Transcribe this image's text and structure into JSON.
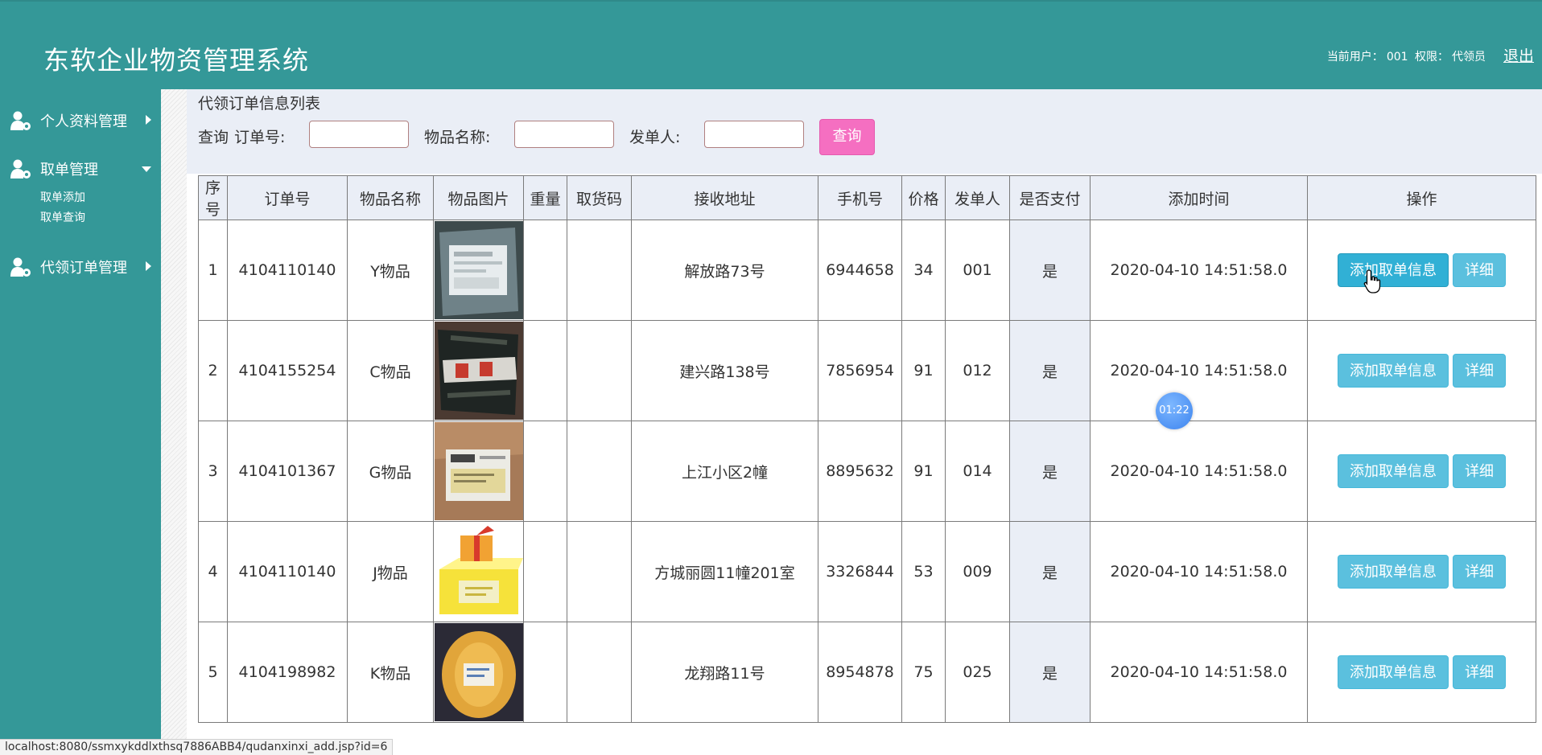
{
  "header": {
    "title": "东软企业物资管理系统",
    "current_user_label": "当前用户：",
    "current_user": "001",
    "permission_label": "权限：",
    "permission": "代领员",
    "logout": "退出"
  },
  "sidebar": {
    "menus": [
      {
        "label": "个人资料管理",
        "icon": "user-gear-icon",
        "arrow": "chevron-right-icon"
      },
      {
        "label": "取单管理",
        "icon": "user-gear-icon",
        "arrow": "chevron-down-icon",
        "sub_items": [
          {
            "label": "取单添加"
          },
          {
            "label": "取单查询"
          }
        ]
      },
      {
        "label": "代领订单管理",
        "icon": "user-gear-icon",
        "arrow": "chevron-right-icon"
      }
    ]
  },
  "main": {
    "heading": "代领订单信息列表",
    "search": {
      "prefix": "查询",
      "order_no_label": "订单号:",
      "item_name_label": "物品名称:",
      "sender_label": "发单人:",
      "order_no_value": "",
      "item_name_value": "",
      "sender_value": "",
      "button": "查询"
    },
    "table": {
      "columns": [
        "序号",
        "订单号",
        "物品名称",
        "物品图片",
        "重量",
        "取货码",
        "接收地址",
        "手机号",
        "价格",
        "发单人",
        "是否支付",
        "添加时间",
        "操作"
      ],
      "rows": [
        {
          "no": "1",
          "order": "4104110140",
          "name": "Y物品",
          "image": "gray-package-photo",
          "weight": "",
          "code": "",
          "address": "解放路73号",
          "phone": "6944658",
          "price": "34",
          "sender": "001",
          "paid": "是",
          "time": "2020-04-10 14:51:58.0"
        },
        {
          "no": "2",
          "order": "4104155254",
          "name": "C物品",
          "image": "black-parcel-photo",
          "weight": "",
          "code": "",
          "address": "建兴路138号",
          "phone": "7856954",
          "price": "91",
          "sender": "012",
          "paid": "是",
          "time": "2020-04-10 14:51:58.0"
        },
        {
          "no": "3",
          "order": "4104101367",
          "name": "G物品",
          "image": "cardboard-box-photo",
          "weight": "",
          "code": "",
          "address": "上江小区2幢",
          "phone": "8895632",
          "price": "91",
          "sender": "014",
          "paid": "是",
          "time": "2020-04-10 14:51:58.0"
        },
        {
          "no": "4",
          "order": "4104110140",
          "name": "J物品",
          "image": "yellow-box-illustration",
          "weight": "",
          "code": "",
          "address": "方城丽圆11幢201室",
          "phone": "3326844",
          "price": "53",
          "sender": "009",
          "paid": "是",
          "time": "2020-04-10 14:51:58.0"
        },
        {
          "no": "5",
          "order": "4104198982",
          "name": "K物品",
          "image": "yellow-parcel-photo",
          "weight": "",
          "code": "",
          "address": "龙翔路11号",
          "phone": "8954878",
          "price": "75",
          "sender": "025",
          "paid": "是",
          "time": "2020-04-10 14:51:58.0"
        }
      ],
      "add_button": "添加取单信息",
      "detail_button": "详细"
    }
  },
  "overlay": {
    "timer": "01:22"
  },
  "statusbar": {
    "url": "localhost:8080/ssmxykddlxthsq7886ABB4/qudanxinxi_add.jsp?id=6"
  },
  "colors": {
    "teal": "#349898",
    "pink": "#f56fc1",
    "button_blue": "#5bc0de",
    "header_bg": "#eaeef6"
  }
}
